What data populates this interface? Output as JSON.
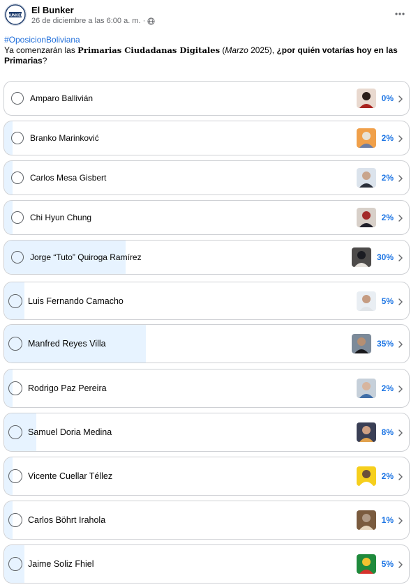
{
  "post": {
    "page_name": "El Bunker",
    "timestamp": "26 de diciembre a las 6:00 a. m. ·",
    "audience_icon": "globe-icon",
    "more_icon": "more-dots-icon",
    "avatar_text": "BUNKER"
  },
  "content": {
    "hashtag": "#OposicionBoliviana",
    "text_1": "Ya comenzarán las ",
    "text_bold_1": "Primarias Ciudadanas Digitales",
    "text_2": " (",
    "text_italic": "Marzo",
    "text_3": " 2025), ",
    "text_bold_2": "¿por quién votarías hoy en las Primarias",
    "text_4": "?"
  },
  "poll": {
    "accent_color": "#1b74e4",
    "fill_color": "#e7f3ff",
    "options": [
      {
        "label": "Amparo Ballivián",
        "percent": "0%",
        "value": 0
      },
      {
        "label": "Branko Marinković",
        "percent": "2%",
        "value": 2
      },
      {
        "label": "Carlos Mesa Gisbert",
        "percent": "2%",
        "value": 2
      },
      {
        "label": "Chi Hyun Chung",
        "percent": "2%",
        "value": 2
      },
      {
        "label": "Jorge “Tuto” Quiroga Ramírez",
        "percent": "30%",
        "value": 30
      },
      {
        "label": "Luis Fernando Camacho",
        "percent": "5%",
        "value": 5
      },
      {
        "label": "Manfred Reyes Villa",
        "percent": "35%",
        "value": 35
      },
      {
        "label": "Rodrigo Paz Pereira",
        "percent": "2%",
        "value": 2
      },
      {
        "label": "Samuel Doria Medina",
        "percent": "8%",
        "value": 8
      },
      {
        "label": "Vicente Cuellar Téllez",
        "percent": "2%",
        "value": 2
      },
      {
        "label": "Carlos Böhrt Irahola",
        "percent": "1%",
        "value": 1
      },
      {
        "label": "Jaime Soliz Fhiel",
        "percent": "5%",
        "value": 5
      }
    ]
  }
}
